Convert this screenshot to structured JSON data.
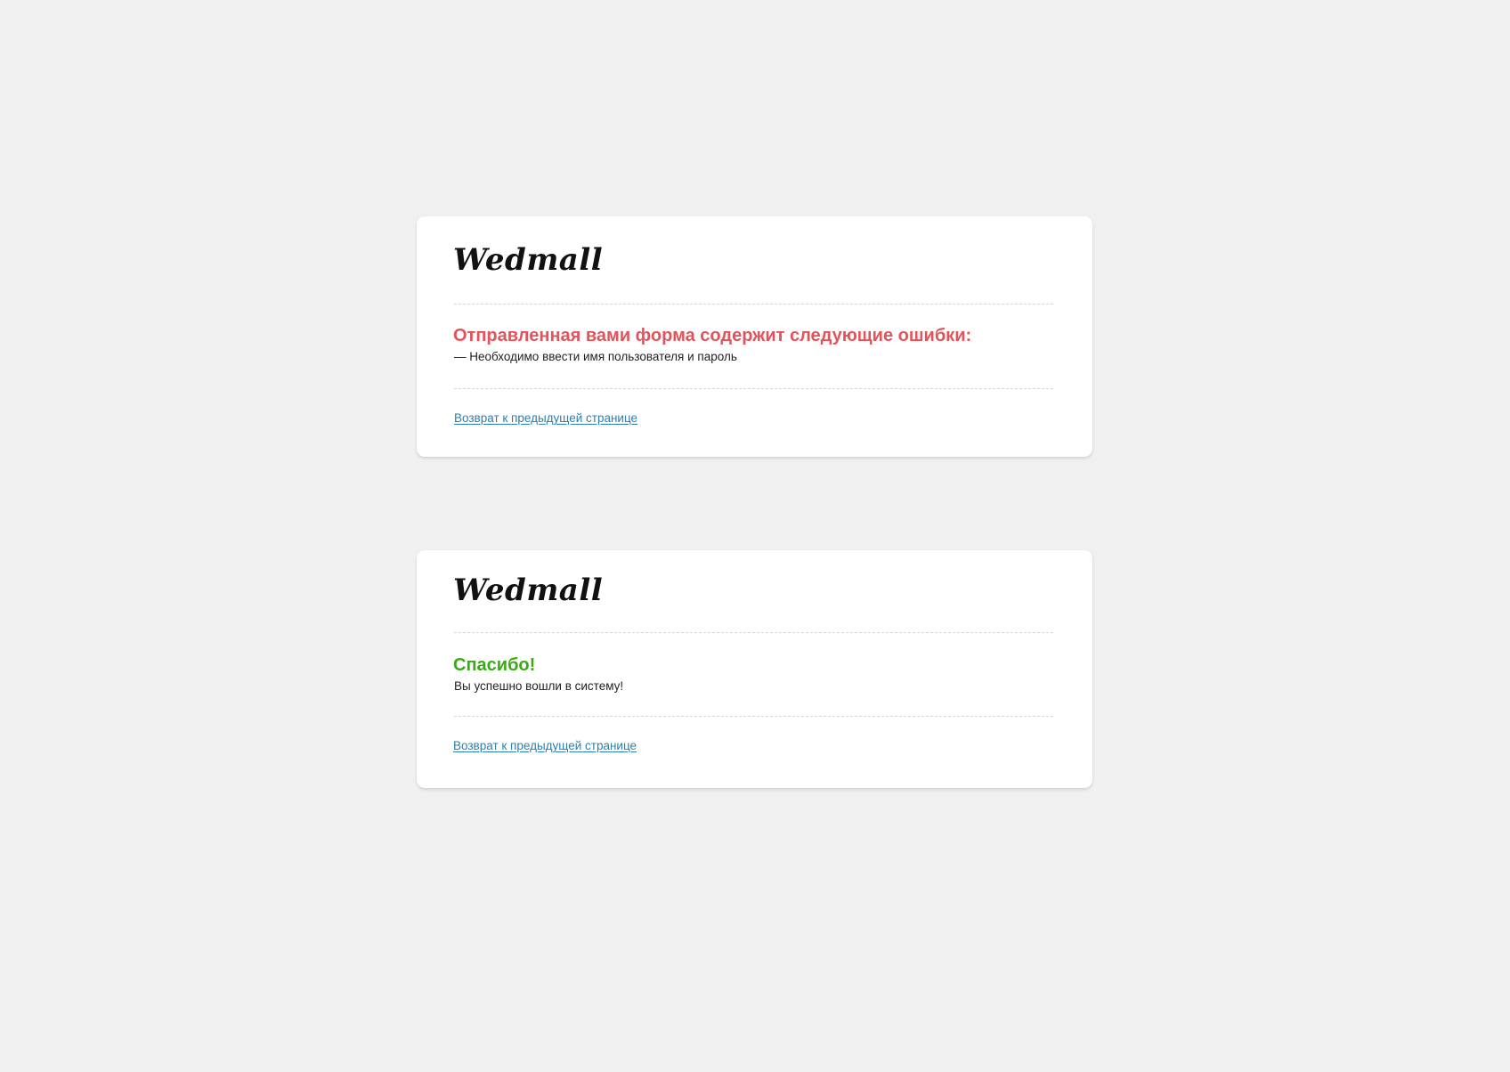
{
  "error_card": {
    "logo": "Wedmall",
    "heading": "Отправленная вами форма содержит следующие ошибки:",
    "message": "— Необходимо ввести имя пользователя и пароль",
    "back_link": "Возврат к предыдущей странице"
  },
  "success_card": {
    "logo": "Wedmall",
    "heading": "Спасибо!",
    "message": "Вы успешно вошли в систему!",
    "back_link": "Возврат к предыдущей странице"
  },
  "colors": {
    "background": "#f0f0f0",
    "card": "#ffffff",
    "error": "#e4525a",
    "success": "#3aaa14",
    "link": "#2a7fb0"
  }
}
